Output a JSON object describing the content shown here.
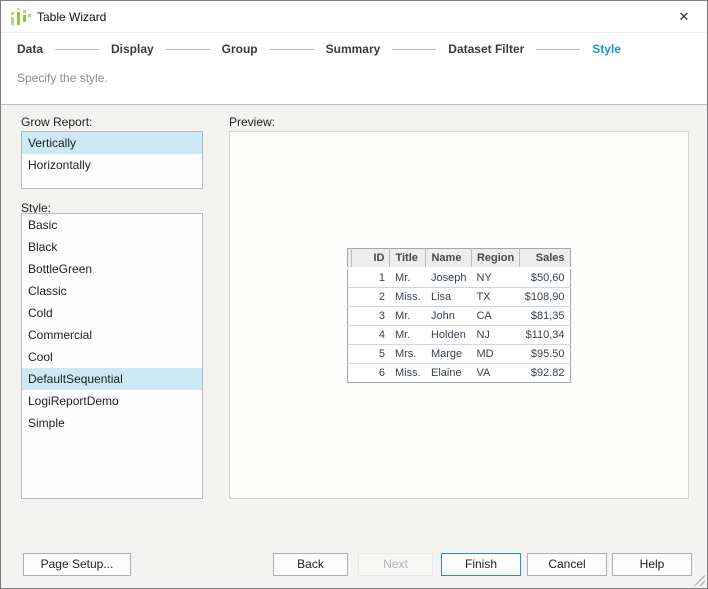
{
  "window": {
    "title": "Table Wizard",
    "close_glyph": "✕"
  },
  "steps": {
    "items": [
      "Data",
      "Display",
      "Group",
      "Summary",
      "Dataset Filter",
      "Style"
    ],
    "active": "Style"
  },
  "subtitle": "Specify the style.",
  "grow_report": {
    "label": "Grow Report:",
    "options": [
      "Vertically",
      "Horizontally"
    ],
    "selected": "Vertically"
  },
  "style_list": {
    "label": "Style:",
    "options": [
      "Basic",
      "Black",
      "BottleGreen",
      "Classic",
      "Cold",
      "Commercial",
      "Cool",
      "DefaultSequential",
      "LogiReportDemo",
      "Simple"
    ],
    "selected": "DefaultSequential"
  },
  "preview": {
    "label": "Preview:",
    "table": {
      "columns": [
        "ID",
        "Title",
        "Name",
        "Region",
        "Sales"
      ],
      "align": [
        "right",
        "left",
        "left",
        "left",
        "right"
      ],
      "rows": [
        [
          "1",
          "Mr.",
          "Joseph",
          "NY",
          "$50,60"
        ],
        [
          "2",
          "Miss.",
          "Lisa",
          "TX",
          "$108,90"
        ],
        [
          "3",
          "Mr.",
          "John",
          "CA",
          "$81,35"
        ],
        [
          "4",
          "Mr.",
          "Holden",
          "NJ",
          "$110,34"
        ],
        [
          "5",
          "Mrs.",
          "Marge",
          "MD",
          "$95.50"
        ],
        [
          "6",
          "Miss.",
          "Elaine",
          "VA",
          "$92.82"
        ]
      ]
    }
  },
  "buttons": {
    "page_setup": "Page Setup...",
    "back": "Back",
    "next": "Next",
    "finish": "Finish",
    "cancel": "Cancel",
    "help": "Help"
  },
  "colors": {
    "accent_blue": "#1a96d5",
    "selection_blue": "#cce8f5",
    "finish_border": "#2a8ad4",
    "icon_green": "#8dc63f"
  }
}
